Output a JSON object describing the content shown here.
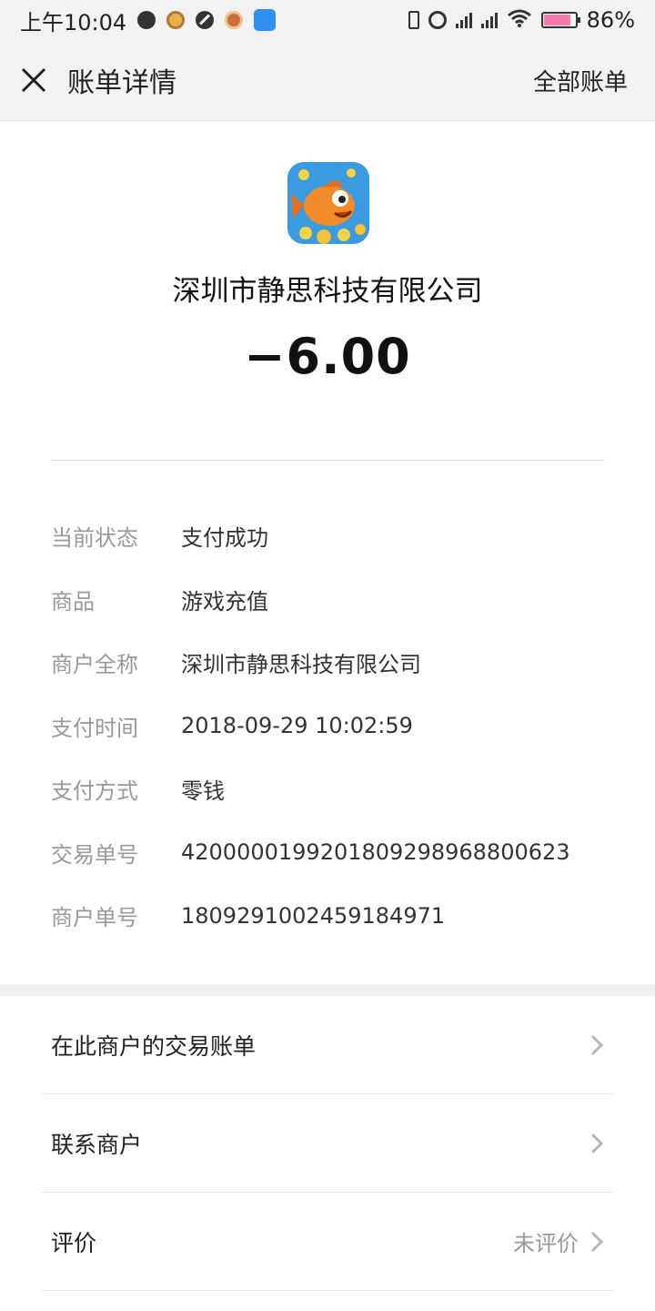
{
  "status_bar": {
    "time": "上午10:04",
    "battery_percent": "86%",
    "battery_level": 0.86,
    "icons": [
      "notification-dot-icon",
      "app-badge-icon",
      "do-not-disturb-icon",
      "avatar-badge-icon",
      "bluetooth-icon",
      "vibrate-icon",
      "alarm-icon",
      "signal-icon",
      "signal-icon",
      "wifi-icon",
      "battery-icon"
    ]
  },
  "header": {
    "title": "账单详情",
    "right_action": "全部账单",
    "close_icon": "close-icon"
  },
  "merchant": {
    "logo_icon": "fish-game-logo",
    "name": "深圳市静思科技有限公司",
    "amount": "−6.00"
  },
  "details": [
    {
      "label": "当前状态",
      "value": "支付成功"
    },
    {
      "label": "商品",
      "value": "游戏充值"
    },
    {
      "label": "商户全称",
      "value": "深圳市静思科技有限公司"
    },
    {
      "label": "支付时间",
      "value": "2018-09-29 10:02:59"
    },
    {
      "label": "支付方式",
      "value": "零钱"
    },
    {
      "label": "交易单号",
      "value": "4200000199201809298968800623"
    },
    {
      "label": "商户单号",
      "value": "1809291002459184971"
    }
  ],
  "links": [
    {
      "label": "在此商户的交易账单",
      "extra": ""
    },
    {
      "label": "联系商户",
      "extra": ""
    },
    {
      "label": "评价",
      "extra": "未评价"
    }
  ],
  "colors": {
    "bar_bg": "#f2f2f2",
    "label_gray": "#999999",
    "battery_pink": "#f47ab0"
  }
}
